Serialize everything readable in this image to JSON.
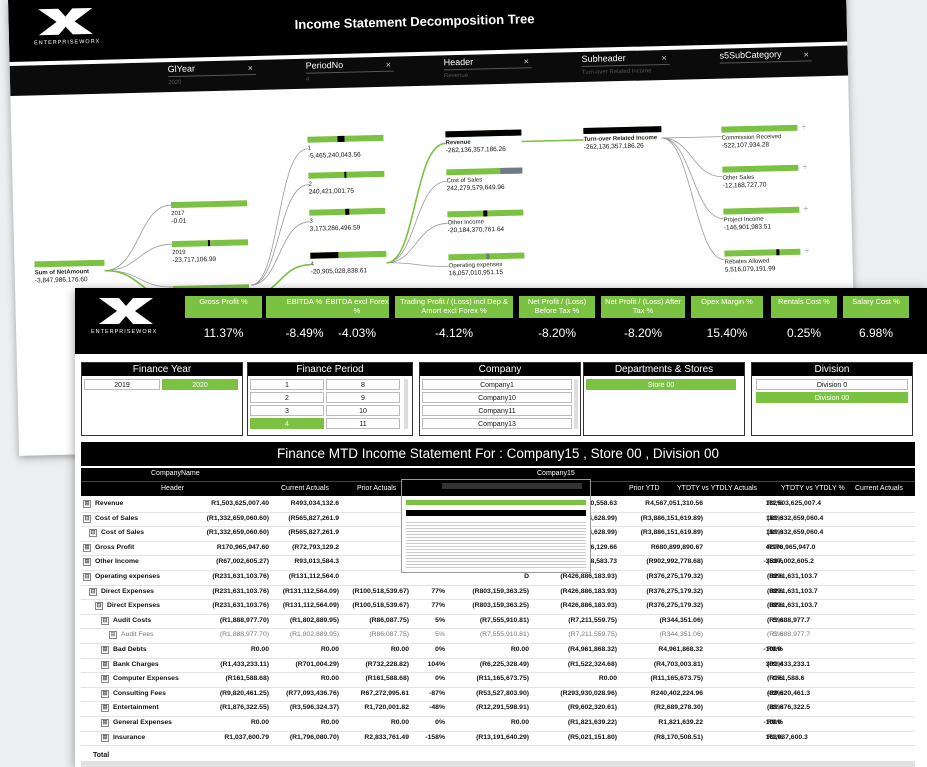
{
  "back": {
    "logo_text": "ENTERPRISEWORX",
    "title": "Income Statement Decomposition Tree",
    "filters": [
      {
        "name": "GlYear",
        "value": "2020"
      },
      {
        "name": "PeriodNo",
        "value": "4"
      },
      {
        "name": "Header",
        "value": "Revenue"
      },
      {
        "name": "Subheader",
        "value": "Turn-over Related Income"
      },
      {
        "name": "s5SubCategory",
        "value": ""
      }
    ],
    "root": {
      "label": "Sum of NetAmount",
      "value": "-3,847,986,176.60"
    },
    "year_nodes": [
      {
        "label": "2017",
        "value": "-0.01"
      },
      {
        "label": "2019",
        "value": "-23,717,106.99"
      }
    ],
    "period_nodes": [
      {
        "label": "1",
        "value": "-5,465,240,043.56"
      },
      {
        "label": "2",
        "value": "240,421,001.75"
      },
      {
        "label": "3",
        "value": "3,173,286,496.59"
      },
      {
        "label": "4",
        "value": "-20,905,028,838.61"
      }
    ],
    "header_nodes": [
      {
        "label": "Revenue",
        "value": "-262,136,357,186.26"
      },
      {
        "label": "Cost of Sales",
        "value": "242,279,579,649.96"
      },
      {
        "label": "Other Income",
        "value": "-20,184,370,761.64"
      },
      {
        "label": "Operating expenses",
        "value": "16,057,010,951.15"
      }
    ],
    "subheader_node": {
      "label": "Turn-over Related Income",
      "value": "-262,136,357,186.26"
    },
    "subcat_nodes": [
      {
        "label": "Commission Received",
        "value": "-522,107,934.28"
      },
      {
        "label": "Other Sales",
        "value": "-12,168,727.70"
      },
      {
        "label": "Project Income",
        "value": "-146,901,983.51"
      },
      {
        "label": "Rebates Allowed",
        "value": "5,516,079,191.99"
      }
    ]
  },
  "front": {
    "logo_text": "ENTERPRISEWORX",
    "kpis": [
      {
        "title": "Gross Profit %",
        "value": "11.37%"
      },
      {
        "title": "EBITDA %",
        "value": "-8.49%"
      },
      {
        "title": "EBITDA excl Forex %",
        "value": "-4.03%"
      },
      {
        "title": "Trading Profit / (Loss) incl Dep & Amort excl Forex %",
        "value": "-4.12%"
      },
      {
        "title": "Net Profit / (Loss) Before Tax %",
        "value": "-8.20%"
      },
      {
        "title": "Net Profit / (Loss) After Tax %",
        "value": "-8.20%"
      },
      {
        "title": "Opex Margin %",
        "value": "15.40%"
      },
      {
        "title": "Rentals Cost %",
        "value": "0.25%"
      },
      {
        "title": "Salary Cost %",
        "value": "6.98%"
      }
    ],
    "slicers": {
      "finance_year": {
        "title": "Finance Year",
        "options": [
          "2019",
          "2020"
        ],
        "selected": "2020"
      },
      "finance_period": {
        "title": "Finance Period",
        "options": [
          "1",
          "8",
          "2",
          "9",
          "3",
          "10",
          "4",
          "11"
        ],
        "selected": "4"
      },
      "company": {
        "title": "Company",
        "options": [
          "Company1",
          "Company10",
          "Company11",
          "Company13"
        ]
      },
      "departments": {
        "title": "Departments & Stores",
        "options": [
          "Store 00"
        ],
        "selected": "Store 00"
      },
      "division": {
        "title": "Division",
        "options": [
          "Division 0",
          "Division 00"
        ],
        "selected": "Division 00"
      }
    },
    "statement_title": "Finance MTD Income Statement For :  Company15 , Store 00 , Division 00",
    "matrix": {
      "company_label": "CompanyName",
      "company_value": "Company15",
      "header_label": "Header",
      "columns": [
        "Current Actuals",
        "Prior Actuals",
        "Prior YTD",
        "YTDTY vs YTDLY Actuals",
        "YTDTY vs YTDLY %",
        "Current Actuals"
      ],
      "rows": [
        {
          "label": "Revenue",
          "icon": "⊞",
          "c1": "R1,503,625,007.40",
          "c2": "R493,034,132.6",
          "c3": "",
          "c4": "",
          "c5": "9",
          "c6": "R3,669,570,558.63",
          "c7": "R4,567,051,310.56",
          "c8": "132%",
          "c9": "R1,503,625,007.4"
        },
        {
          "label": "Cost of Sales",
          "icon": "⊟",
          "c1": "(R1,332,659,060.60)",
          "c2": "(R565,827,261.9",
          "c3": "",
          "c4": "",
          "c5": "D",
          "c6": "(R3,298,724,628.99)",
          "c7": "(R3,886,151,619.89)",
          "c8": "118%",
          "c9": "(R1,332,659,060.4"
        },
        {
          "label": "Cost of Sales",
          "icon": "⊟",
          "c1": "(R1,332,659,060.60)",
          "c2": "(R565,827,261.9",
          "c3": "",
          "c4": "",
          "c5": "D",
          "c6": "(R3,298,724,628.99)",
          "c7": "(R3,886,151,619.89)",
          "c8": "118%",
          "c9": "(R1,332,659,060.4"
        },
        {
          "label": "Gross Profit",
          "icon": "⊞",
          "c1": "R170,965,947.60",
          "c2": "(R72,793,129.2",
          "c3": "",
          "c4": "",
          "c5": "D",
          "c6": "R158,866,129.66",
          "c7": "R680,899,890.67",
          "c8": "429%",
          "c9": "R170,965,947.0"
        },
        {
          "label": "Other Income",
          "icon": "⊞",
          "c1": "(R67,002,605.27)",
          "c2": "R93,013,584.3",
          "c3": "",
          "c4": "",
          "c5": "D",
          "c6": "R255,588,583.73",
          "c7": "(R902,992,778.68)",
          "c8": "-353%",
          "c9": "(R67,002,605.2"
        },
        {
          "label": "Operating expenses",
          "icon": "⊟",
          "c1": "(R231,631,103.76)",
          "c2": "(R131,112,564.0",
          "c3": "",
          "c4": "",
          "c5": "D",
          "c6": "(R426,886,183.93)",
          "c7": "(R376,275,179.32)",
          "c8": "88%",
          "c9": "(R231,631,103.7"
        },
        {
          "label": "Direct Expenses",
          "icon": "⊟",
          "c1": "(R231,631,103.76)",
          "c2": "(R131,112,564.09)",
          "c3": "(R100,518,539.67)",
          "c4": "77%",
          "c5": "(R803,159,363.25)",
          "c6": "(R426,886,183.93)",
          "c7": "(R376,275,179.32)",
          "c8": "88%",
          "c9": "(R231,631,103.7"
        },
        {
          "label": "Direct Expenses",
          "icon": "⊟",
          "c1": "(R231,631,103.76)",
          "c2": "(R131,112,564.09)",
          "c3": "(R100,518,539.67)",
          "c4": "77%",
          "c5": "(R803,159,363.25)",
          "c6": "(R426,886,183.93)",
          "c7": "(R376,275,179.32)",
          "c8": "88%",
          "c9": "(R231,631,103.7"
        },
        {
          "label": "Audit Costs",
          "icon": "⊟",
          "c1": "(R1,888,977.70)",
          "c2": "(R1,802,889.95)",
          "c3": "(R86,087.75)",
          "c4": "5%",
          "c5": "(R7,555,910.81)",
          "c6": "(R7,211,559.75)",
          "c7": "(R344,351.06)",
          "c8": "5%",
          "c9": "(R1,888,977.7"
        },
        {
          "label": "Audit Fees",
          "icon": "⊞",
          "c1": "(R1,888,977.70)",
          "c2": "(R1,802,889.95)",
          "c3": "(R86,087.75)",
          "c4": "5%",
          "c5": "(R7,555,910.81)",
          "c6": "(R7,211,559.75)",
          "c7": "(R344,351.06)",
          "c8": "5%",
          "c9": "(R1,888,977.7"
        },
        {
          "label": "Bad Debts",
          "icon": "⊞",
          "c1": "R0.00",
          "c2": "R0.00",
          "c3": "R0.00",
          "c4": "0%",
          "c5": "R0.00",
          "c6": "(R4,961,868.32)",
          "c7": "R4,961,868.32",
          "c8": "-100%",
          "c9": "R0.0"
        },
        {
          "label": "Bank Charges",
          "icon": "⊞",
          "c1": "(R1,433,233.11)",
          "c2": "(R701,004.29)",
          "c3": "(R732,228.82)",
          "c4": "104%",
          "c5": "(R6,225,328.49)",
          "c6": "(R1,522,324.68)",
          "c7": "(R4,703,003.81)",
          "c8": "309%",
          "c9": "(R1,433,233.1"
        },
        {
          "label": "Computer Expenses",
          "icon": "⊞",
          "c1": "(R161,588.68)",
          "c2": "R0.00",
          "c3": "(R161,588.68)",
          "c4": "0%",
          "c5": "(R11,165,673.75)",
          "c6": "R0.00",
          "c7": "(R11,165,673.75)",
          "c8": "0%",
          "c9": "(R161,588.6"
        },
        {
          "label": "Consulting Fees",
          "icon": "⊞",
          "c1": "(R9,820,461.25)",
          "c2": "(R77,093,436.76)",
          "c3": "R67,272,995.61",
          "c4": "-87%",
          "c5": "(R53,527,803.90)",
          "c6": "(R293,930,028.96)",
          "c7": "R240,402,224.96",
          "c8": "-82%",
          "c9": "(R9,820,461.3"
        },
        {
          "label": "Entertainment",
          "icon": "⊞",
          "c1": "(R1,876,322.55)",
          "c2": "(R3,596,324.37)",
          "c3": "R1,720,001.82",
          "c4": "-48%",
          "c5": "(R12,291,598.91)",
          "c6": "(R9,602,320.61)",
          "c7": "(R2,689,278.30)",
          "c8": "28%",
          "c9": "(R1,876,322.5"
        },
        {
          "label": "General Expenses",
          "icon": "⊞",
          "c1": "R0.00",
          "c2": "R0.00",
          "c3": "R0.00",
          "c4": "0%",
          "c5": "R0.00",
          "c6": "(R1,821,639.22)",
          "c7": "R1,821,639.22",
          "c8": "-100%",
          "c9": "R0.0"
        },
        {
          "label": "Insurance",
          "icon": "⊞",
          "c1": "R1,037,600.79",
          "c2": "(R1,796,080.70)",
          "c3": "R2,833,761.49",
          "c4": "-158%",
          "c5": "(R13,191,640.29)",
          "c6": "(R5,021,151.80)",
          "c7": "(R8,170,508.51)",
          "c8": "163%",
          "c9": "R1,037,600.3"
        }
      ],
      "total_label": "Total"
    }
  },
  "colors": {
    "accent": "#7cc242",
    "dark": "#000000",
    "gray": "#6e7b86"
  }
}
